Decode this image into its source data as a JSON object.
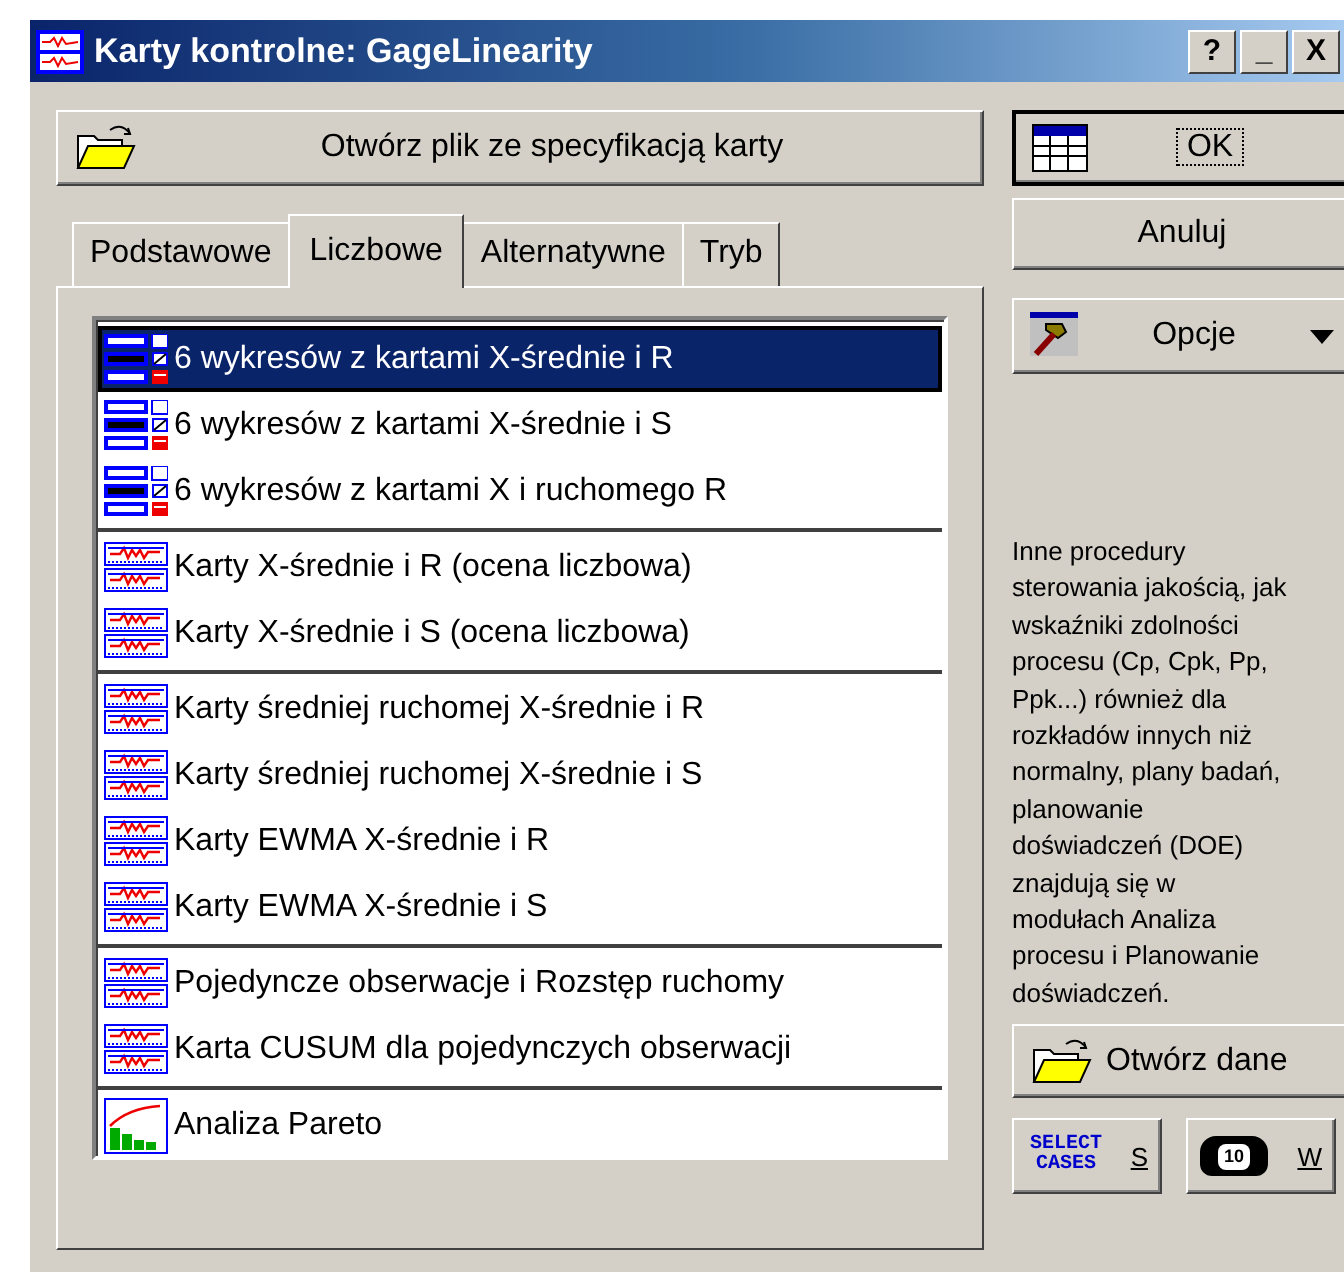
{
  "window": {
    "title": "Karty kontrolne: GageLinearity",
    "controls": [
      "?",
      "_",
      "X"
    ]
  },
  "open_spec_button": {
    "label": "Otwórz plik ze specyfikacją karty"
  },
  "tabs": [
    {
      "label": "Podstawowe",
      "selected": false
    },
    {
      "label": "Liczbowe",
      "selected": true
    },
    {
      "label": "Alternatywne",
      "selected": false
    },
    {
      "label": "Tryb",
      "selected": false
    }
  ],
  "chart_list": {
    "groups": [
      {
        "items": [
          {
            "label": "6 wykresów z kartami X-średnie i R",
            "kind": "multi",
            "selected": true
          },
          {
            "label": "6 wykresów z kartami X-średnie i S",
            "kind": "multi",
            "selected": false
          },
          {
            "label": "6 wykresów z kartami X i ruchomego R",
            "kind": "multi",
            "selected": false
          }
        ]
      },
      {
        "items": [
          {
            "label": "Karty X-średnie i R (ocena liczbowa)",
            "kind": "chart",
            "selected": false
          },
          {
            "label": "Karty X-średnie i S (ocena liczbowa)",
            "kind": "chart",
            "selected": false
          }
        ]
      },
      {
        "items": [
          {
            "label": "Karty średniej ruchomej X-średnie i R",
            "kind": "chart",
            "selected": false
          },
          {
            "label": "Karty średniej ruchomej X-średnie i S",
            "kind": "chart",
            "selected": false
          },
          {
            "label": "Karty EWMA X-średnie i R",
            "kind": "chart",
            "selected": false
          },
          {
            "label": "Karty EWMA X-średnie i S",
            "kind": "chart",
            "selected": false
          }
        ]
      },
      {
        "items": [
          {
            "label": "Pojedyncze obserwacje i Rozstęp ruchomy",
            "kind": "chart",
            "selected": false
          },
          {
            "label": "Karta CUSUM dla pojedynczych obserwacji",
            "kind": "chart",
            "selected": false
          }
        ]
      },
      {
        "items": [
          {
            "label": "Analiza Pareto",
            "kind": "pareto",
            "selected": false
          }
        ]
      }
    ]
  },
  "ok_button": {
    "label": "OK"
  },
  "cancel_button": {
    "label": "Anuluj"
  },
  "options_button": {
    "label": "Opcje"
  },
  "info_text": "Inne procedury\nsterowania jakością, jak\nwskaźniki zdolności\nprocesu (Cp, Cpk, Pp,\nPpk...) również dla\nrozkładów innych niż\nnormalny, plany badań,\nplanowanie\ndoświadczeń (DOE)\nznajdują się w\nmodułach Analiza\nprocesu i Planowanie\ndoświadczeń.",
  "open_data_button": {
    "label": "Otwórz dane"
  },
  "select_cases_button": {
    "icon_text": "SELECT CASES",
    "label": "S"
  },
  "weight_button": {
    "icon_text": "10",
    "label": "W"
  }
}
